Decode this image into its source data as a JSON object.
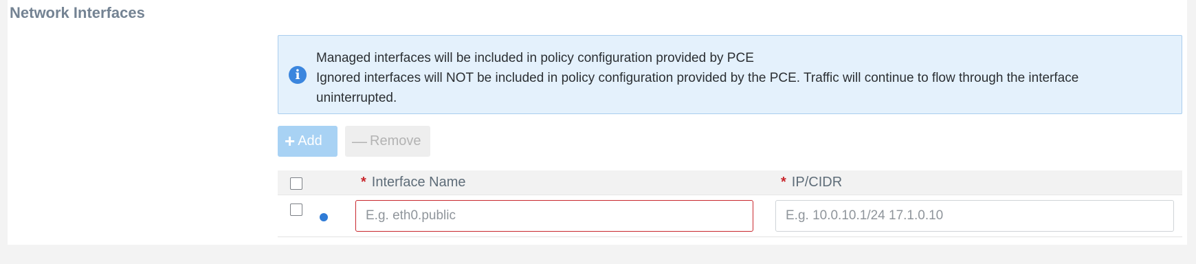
{
  "section": {
    "title": "Network Interfaces"
  },
  "info": {
    "icon": "info-circle-icon",
    "line1": "Managed interfaces will be included in policy configuration provided by PCE",
    "line2": "Ignored interfaces will NOT be included in policy configuration provided by the PCE. Traffic will continue to flow through the interface uninterrupted."
  },
  "toolbar": {
    "add_label": "Add",
    "add_icon": "+",
    "remove_label": "Remove",
    "remove_icon": "—"
  },
  "table": {
    "columns": [
      {
        "required_mark": "*",
        "label": "Interface Name"
      },
      {
        "required_mark": "*",
        "label": "IP/CIDR"
      }
    ],
    "rows": [
      {
        "status_icon": "status-dot-icon",
        "interface_name": {
          "value": "",
          "placeholder": "E.g. eth0.public"
        },
        "ip_cidr": {
          "value": "",
          "placeholder": "E.g. 10.0.10.1/24 17.1.0.10"
        }
      }
    ]
  },
  "colors": {
    "accent": "#3b86de",
    "error": "#c8262c",
    "info_bg": "#e4f1fc",
    "add_button_disabled": "#a8d2f4",
    "title": "#748393"
  }
}
